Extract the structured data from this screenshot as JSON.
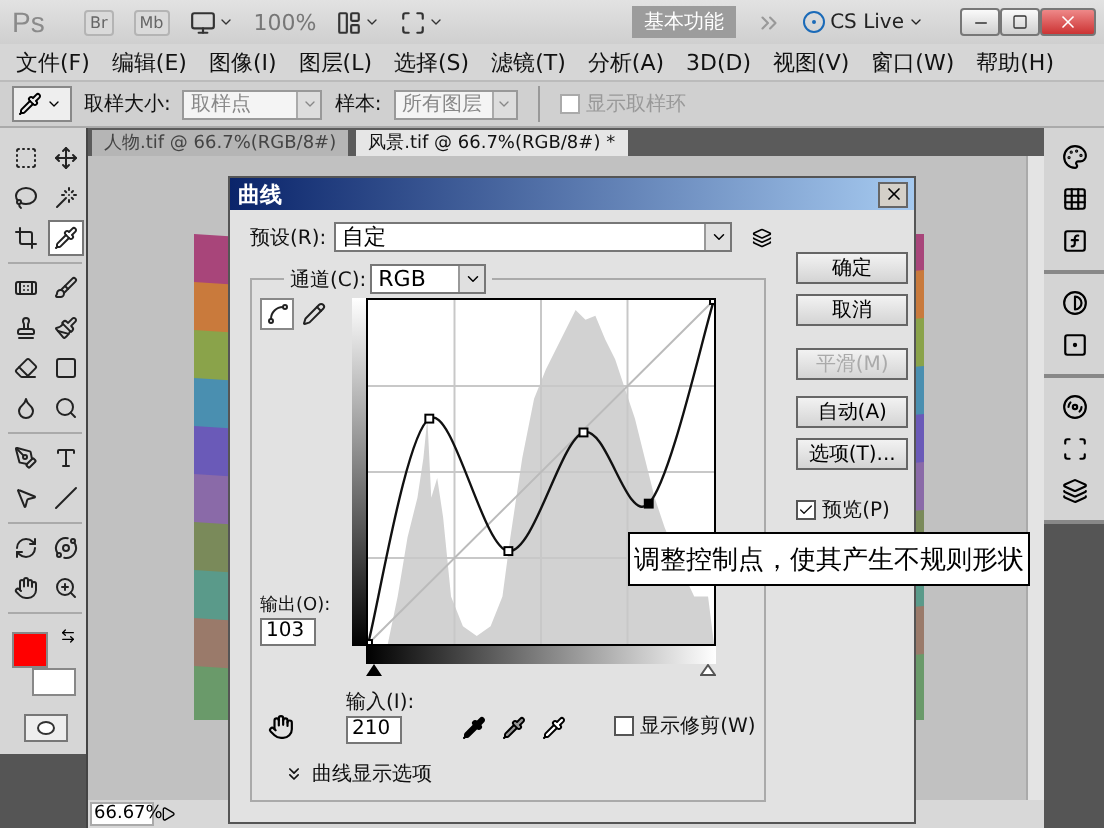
{
  "app_bar": {
    "logo": "Ps",
    "bridge": "Br",
    "mini_bridge": "Mb",
    "zoom": "100%",
    "workspace": "基本功能",
    "cs_live": "CS Live"
  },
  "menu_bar": [
    "文件(F)",
    "编辑(E)",
    "图像(I)",
    "图层(L)",
    "选择(S)",
    "滤镜(T)",
    "分析(A)",
    "3D(D)",
    "视图(V)",
    "窗口(W)",
    "帮助(H)"
  ],
  "options_bar": {
    "sample_size_label": "取样大小:",
    "sample_size": "取样点",
    "sample_label": "样本:",
    "sample": "所有图层",
    "show_ring": {
      "label": "显示取样环",
      "checked": false,
      "disabled": true
    }
  },
  "document_tabs": [
    {
      "label": "人物.tif @ 66.7%(RGB/8#)",
      "selected": false
    },
    {
      "label": "风景.tif @ 66.7%(RGB/8#) *",
      "selected": true
    }
  ],
  "tools": [
    {
      "kind": "marquee",
      "selected": false
    },
    {
      "kind": "move",
      "selected": false
    },
    {
      "kind": "lasso",
      "selected": false
    },
    {
      "kind": "wand",
      "selected": false
    },
    {
      "kind": "crop",
      "selected": false
    },
    {
      "kind": "eyedropper",
      "selected": true
    },
    {
      "kind": "healing",
      "selected": false
    },
    {
      "kind": "brush",
      "selected": false
    },
    {
      "kind": "stamp",
      "selected": false
    },
    {
      "kind": "history",
      "selected": false
    },
    {
      "kind": "eraser",
      "selected": false
    },
    {
      "kind": "gradient",
      "selected": false
    },
    {
      "kind": "blur",
      "selected": false
    },
    {
      "kind": "dodge",
      "selected": false
    },
    {
      "kind": "pen",
      "selected": false
    },
    {
      "kind": "type",
      "selected": false
    },
    {
      "kind": "path",
      "selected": false
    },
    {
      "kind": "line",
      "selected": false
    },
    {
      "kind": "rotate3d",
      "selected": false
    },
    {
      "kind": "orbit3d",
      "selected": false
    },
    {
      "kind": "hand",
      "selected": false
    },
    {
      "kind": "zoom",
      "selected": false
    }
  ],
  "color_swatches": [
    {
      "kind": "foreground",
      "color": "#ff0000"
    },
    {
      "kind": "background",
      "color": "#ffffff"
    }
  ],
  "status_bar": {
    "zoom": "66.67%"
  },
  "dialog": {
    "title": "曲线",
    "preset_label": "预设(R):",
    "preset": "自定",
    "channel_label": "通道(C):",
    "channel": "RGB",
    "curve_tools": [
      {
        "kind": "curve",
        "selected": true
      },
      {
        "kind": "pencil",
        "selected": false
      }
    ],
    "output_label": "输出(O):",
    "output": "103",
    "input_label": "输入(I):",
    "input": "210",
    "show_clipping": {
      "label": "显示修剪(W)",
      "checked": false
    },
    "display_options": "曲线显示选项",
    "buttons": [
      {
        "label": "确定",
        "disabled": false
      },
      {
        "label": "取消",
        "disabled": false
      },
      {
        "label": "平滑(M)",
        "disabled": true
      },
      {
        "label": "自动(A)",
        "disabled": false
      },
      {
        "label": "选项(T)...",
        "disabled": false
      }
    ],
    "preview": {
      "label": "预览(P)",
      "checked": true
    }
  },
  "callout": "调整控制点，使其产生不规则形状"
}
